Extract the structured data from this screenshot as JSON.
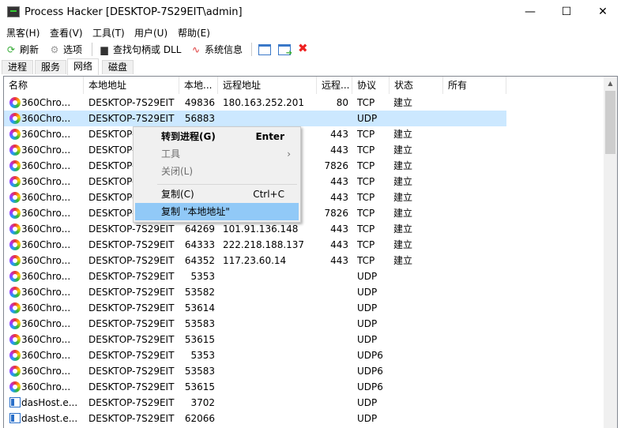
{
  "window": {
    "title": "Process Hacker [DESKTOP-7S29EIT\\admin]",
    "minimize": "—",
    "maximize": "☐",
    "close": "✕"
  },
  "menu": [
    "黑客(H)",
    "查看(V)",
    "工具(T)",
    "用户(U)",
    "帮助(E)"
  ],
  "toolbar": {
    "refresh": "刷新",
    "options": "选项",
    "find": "查找句柄或 DLL",
    "sysinfo": "系统信息"
  },
  "tabs": [
    "进程",
    "服务",
    "网络",
    "磁盘"
  ],
  "columns": [
    "名称",
    "本地地址",
    "本地...",
    "远程地址",
    "远程...",
    "协议",
    "状态",
    "所有"
  ],
  "rows": [
    {
      "name": "360Chro...",
      "local": "DESKTOP-7S29EIT",
      "lport": "49836",
      "remote": "180.163.252.201",
      "rport": "80",
      "proto": "TCP",
      "state": "建立",
      "icon": "p"
    },
    {
      "name": "360Chro...",
      "local": "DESKTOP-7S29EIT",
      "lport": "56883",
      "remote": "",
      "rport": "",
      "proto": "UDP",
      "state": "",
      "icon": "p"
    },
    {
      "name": "360Chro...",
      "local": "DESKTOP-7S29EIT",
      "lport": "",
      "remote": "",
      "rport": "443",
      "proto": "TCP",
      "state": "建立",
      "icon": "p"
    },
    {
      "name": "360Chro...",
      "local": "DESKTOP-7S29EIT",
      "lport": "",
      "remote": "",
      "rport": "443",
      "proto": "TCP",
      "state": "建立",
      "icon": "p"
    },
    {
      "name": "360Chro...",
      "local": "DESKTOP-7S29EIT",
      "lport": "",
      "remote": "",
      "rport": "7826",
      "proto": "TCP",
      "state": "建立",
      "icon": "p"
    },
    {
      "name": "360Chro...",
      "local": "DESKTOP-7S29EIT",
      "lport": "",
      "remote": "",
      "rport": "443",
      "proto": "TCP",
      "state": "建立",
      "icon": "p"
    },
    {
      "name": "360Chro...",
      "local": "DESKTOP-7S29EIT",
      "lport": "",
      "remote": "",
      "rport": "443",
      "proto": "TCP",
      "state": "建立",
      "icon": "p"
    },
    {
      "name": "360Chro...",
      "local": "DESKTOP-7S29EIT",
      "lport": "",
      "remote": "",
      "rport": "7826",
      "proto": "TCP",
      "state": "建立",
      "icon": "p"
    },
    {
      "name": "360Chro...",
      "local": "DESKTOP-7S29EIT",
      "lport": "64269",
      "remote": "101.91.136.148",
      "rport": "443",
      "proto": "TCP",
      "state": "建立",
      "icon": "p"
    },
    {
      "name": "360Chro...",
      "local": "DESKTOP-7S29EIT",
      "lport": "64333",
      "remote": "222.218.188.137",
      "rport": "443",
      "proto": "TCP",
      "state": "建立",
      "icon": "p"
    },
    {
      "name": "360Chro...",
      "local": "DESKTOP-7S29EIT",
      "lport": "64352",
      "remote": "117.23.60.14",
      "rport": "443",
      "proto": "TCP",
      "state": "建立",
      "icon": "p"
    },
    {
      "name": "360Chro...",
      "local": "DESKTOP-7S29EIT",
      "lport": "5353",
      "remote": "",
      "rport": "",
      "proto": "UDP",
      "state": "",
      "icon": "p"
    },
    {
      "name": "360Chro...",
      "local": "DESKTOP-7S29EIT",
      "lport": "53582",
      "remote": "",
      "rport": "",
      "proto": "UDP",
      "state": "",
      "icon": "p"
    },
    {
      "name": "360Chro...",
      "local": "DESKTOP-7S29EIT",
      "lport": "53614",
      "remote": "",
      "rport": "",
      "proto": "UDP",
      "state": "",
      "icon": "p"
    },
    {
      "name": "360Chro...",
      "local": "DESKTOP-7S29EIT",
      "lport": "53583",
      "remote": "",
      "rport": "",
      "proto": "UDP",
      "state": "",
      "icon": "p"
    },
    {
      "name": "360Chro...",
      "local": "DESKTOP-7S29EIT",
      "lport": "53615",
      "remote": "",
      "rport": "",
      "proto": "UDP",
      "state": "",
      "icon": "p"
    },
    {
      "name": "360Chro...",
      "local": "DESKTOP-7S29EIT",
      "lport": "5353",
      "remote": "",
      "rport": "",
      "proto": "UDP6",
      "state": "",
      "icon": "p"
    },
    {
      "name": "360Chro...",
      "local": "DESKTOP-7S29EIT",
      "lport": "53583",
      "remote": "",
      "rport": "",
      "proto": "UDP6",
      "state": "",
      "icon": "p"
    },
    {
      "name": "360Chro...",
      "local": "DESKTOP-7S29EIT",
      "lport": "53615",
      "remote": "",
      "rport": "",
      "proto": "UDP6",
      "state": "",
      "icon": "p"
    },
    {
      "name": "dasHost.e...",
      "local": "DESKTOP-7S29EIT",
      "lport": "3702",
      "remote": "",
      "rport": "",
      "proto": "UDP",
      "state": "",
      "icon": "d"
    },
    {
      "name": "dasHost.e...",
      "local": "DESKTOP-7S29EIT",
      "lport": "62066",
      "remote": "",
      "rport": "",
      "proto": "UDP",
      "state": "",
      "icon": "d"
    }
  ],
  "context_menu": {
    "goto": "转到进程(G)",
    "goto_key": "Enter",
    "tools": "工具",
    "close": "关闭(L)",
    "copy": "复制(C)",
    "copy_key": "Ctrl+C",
    "copy_col": "复制 \"本地地址\""
  }
}
